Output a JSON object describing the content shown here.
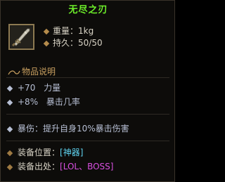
{
  "item": {
    "name": "无尽之刃",
    "icon": "sword-icon",
    "weight_label": "重量：",
    "weight_value": "1kg",
    "durability_label": "持久：",
    "durability_value": "50/50"
  },
  "description": {
    "header": "物品说明",
    "stats": [
      {
        "value": "+70",
        "name": "力量"
      },
      {
        "value": "+8%",
        "name": "暴击几率"
      }
    ],
    "passive": "暴伤：提升自身10%暴击伤害"
  },
  "equip": {
    "slot_label": "装备位置：",
    "slot_value": "[神器]",
    "source_label": "装备出处：",
    "source_value": "[LOL、BOSS]"
  },
  "colors": {
    "title": "#6ef02a",
    "section_header": "#c9a060",
    "slot": "#5fd3f0",
    "source": "#d84fe0"
  }
}
